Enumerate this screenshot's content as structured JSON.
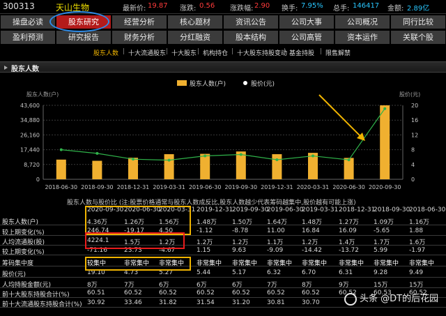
{
  "quote": {
    "code": "300313",
    "name": "天山生物",
    "latest_label": "最新价:",
    "latest": "19.87",
    "change_label": "涨跌:",
    "change": "0.56",
    "pct_label": "涨跌幅:",
    "pct": "2.90",
    "turnover_label": "换手:",
    "turnover": "7.95%",
    "hands_label": "总手:",
    "hands": "146417",
    "amount_label": "金额:",
    "amount": "2.89亿"
  },
  "nav_row1": [
    "操盘必读",
    "股东研究",
    "经营分析",
    "核心题材",
    "资讯公告",
    "公司大事",
    "公司概况",
    "同行比较"
  ],
  "nav_row2": [
    "盈利预测",
    "研究报告",
    "财务分析",
    "分红融资",
    "股本结构",
    "公司高管",
    "资本运作",
    "关联个股"
  ],
  "active_nav": "股东研究",
  "subtabs": [
    "股东人数",
    "十大流通股东",
    "十大股东",
    "机构持仓",
    "十大股东持股变动",
    "基金持股",
    "限售解禁"
  ],
  "section_title": "股东人数",
  "chart_data": {
    "type": "bar",
    "legend": [
      "股东人数(户)",
      "股价(元)"
    ],
    "left_axis_title": "股东人数(户)",
    "right_axis_title": "股价(元)",
    "left_ticks": [
      "43,600",
      "34,880",
      "26,160",
      "17,440",
      "8,720",
      "0"
    ],
    "right_ticks": [
      "20",
      "16",
      "12",
      "8",
      "4",
      "0"
    ],
    "ylim_left": [
      0,
      43600
    ],
    "ylim_right": [
      0,
      20
    ],
    "categories": [
      "2018-06-30",
      "2018-09-30",
      "2018-12-31",
      "2019-03-31",
      "2019-06-30",
      "2019-09-30",
      "2019-12-31",
      "2020-03-31",
      "2020-06-30",
      "2020-09-30"
    ],
    "xtick_labels": [
      "2018-06-30",
      "2018-09-30",
      "2018-12-31",
      "2019-03-31",
      "2019-06-30",
      "2019-09-30",
      "2019-12-31",
      "2020-03-31",
      "2020-06-30",
      "2020-09-30"
    ],
    "series": [
      {
        "name": "股东人数(户)",
        "type": "bar",
        "axis": "left",
        "values": [
          11600,
          10900,
          12700,
          14800,
          15000,
          16400,
          14800,
          15600,
          12600,
          43600
        ]
      },
      {
        "name": "股价(元)",
        "type": "line",
        "axis": "right",
        "values": [
          8.0,
          7.0,
          5.44,
          5.17,
          6.32,
          6.7,
          5.28,
          6.31,
          5.27,
          19.1
        ]
      }
    ]
  },
  "caption": "股东人数与股价比 (注:股票价格通常与股东人数成反比,股东人数越少代表筹码越集中,股价越有可能上涨)",
  "table": {
    "dates": [
      "2020-09-30",
      "2020-06-30",
      "2020-03-31",
      "2019-12-31",
      "2019-09-30",
      "2019-06-30",
      "2019-03-31",
      "2018-12-31",
      "2018-09-30",
      "2018-06-30"
    ],
    "rows": [
      {
        "label": "股东人数(户)",
        "values": [
          "4.36万",
          "1.26万",
          "1.56万",
          "1.48万",
          "1.50万",
          "1.64万",
          "1.48万",
          "1.27万",
          "1.09万",
          "1.16万"
        ]
      },
      {
        "label": "较上期变化(%)",
        "values": [
          "246.74",
          "-19.17",
          "4.50",
          "-1.12",
          "-8.78",
          "11.00",
          "16.84",
          "16.09",
          "-5.65",
          "1.88"
        ]
      },
      {
        "label": "人均流通股(股)",
        "values": [
          "4224.1",
          "1.5万",
          "1.2万",
          "1.2万",
          "1.2万",
          "1.1万",
          "1.2万",
          "1.4万",
          "1.7万",
          "1.6万"
        ]
      },
      {
        "label": "较上期变化(%)",
        "values": [
          "-71.16",
          "23.73",
          "-4.67",
          "1.15",
          "9.63",
          "-9.09",
          "-14.42",
          "-13.72",
          "5.99",
          "-1.97"
        ]
      },
      {
        "label": "筹码集中度",
        "values": [
          "较集中",
          "非常集中",
          "非常集中",
          "非常集中",
          "非常集中",
          "非常集中",
          "非常集中",
          "非常集中",
          "非常集中",
          "非常集中"
        ]
      },
      {
        "label": "股价(元)",
        "values": [
          "19.10",
          "4.73",
          "5.27",
          "5.44",
          "5.17",
          "6.32",
          "6.70",
          "6.31",
          "9.28",
          "9.49"
        ]
      },
      {
        "label": "人均持股金额(元)",
        "values": [
          "8万",
          "7万",
          "6万",
          "6万",
          "6万",
          "7万",
          "8万",
          "9万",
          "15万",
          "15万"
        ]
      },
      {
        "label": "前十大股东持股合计(%)",
        "values": [
          "60.51",
          "60.52",
          "60.52",
          "60.52",
          "60.52",
          "60.52",
          "60.52",
          "60.52",
          "60.53",
          "60.52"
        ]
      },
      {
        "label": "前十大流通股东持股合计(%)",
        "values": [
          "30.92",
          "33.46",
          "31.82",
          "31.54",
          "31.20",
          "30.81",
          "30.70",
          "",
          "",
          ""
        ]
      }
    ]
  },
  "watermark": "头条 @DT的后花园",
  "colors": {
    "bar": "#f0b030",
    "line": "#2fb34a",
    "up": "#ff3b3b",
    "accent": "#29c7ff",
    "nav_active": "#b31b1b",
    "ellipse": "#2d8be8",
    "arrow": "#f0b400"
  }
}
